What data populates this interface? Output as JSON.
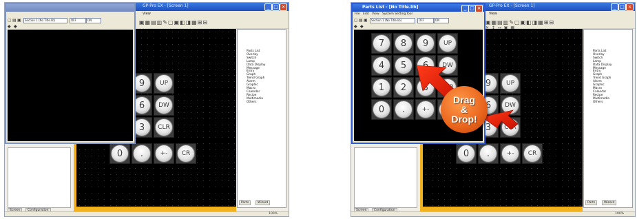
{
  "main_window": {
    "title": "GP-Pro EX - [Screen 1]",
    "menu": [
      "View"
    ],
    "toolbar_glyphs": "▣▦▤▥✎▢▣◧◨▦⊞⊟",
    "toolbar_glyphs2": "✕ ↕ ↔ ▣ ▦",
    "status": "100%"
  },
  "parts_panel": {
    "items": [
      "Parts List",
      "Overlay",
      "Switch",
      "Lamp",
      "Data Display",
      "Message",
      "Entry",
      "Graph",
      "Trend Graph",
      "Alarm",
      "Graphic",
      "Macro",
      "Calendar",
      "Recipe",
      "Multimedia",
      "Others"
    ],
    "tabs": [
      "Parts",
      "Wizard"
    ]
  },
  "bottom_tabs": [
    "Screen",
    "Configuration"
  ],
  "keypad": {
    "rows": [
      [
        "7",
        "8",
        "9",
        "UP"
      ],
      [
        "4",
        "5",
        "6",
        "DW"
      ],
      [
        "1",
        "2",
        "3",
        "CLR"
      ],
      [
        "0",
        ".",
        "+-",
        "CR"
      ]
    ]
  },
  "popup": {
    "title": "Parts List - [No Title.lib]",
    "menu": [
      "File",
      "Edit",
      "View",
      "System Setting",
      "Tool"
    ],
    "combo1": "Section 1 (No Title.lib)",
    "combo2": "OFF",
    "combo3": "ON"
  },
  "badge": {
    "line1": "Drag",
    "line2": "&",
    "line3": "Drop!"
  },
  "colors": {
    "accent": "#e9641c",
    "frame": "#f2b21e",
    "titlebar": "#1f52c6"
  }
}
